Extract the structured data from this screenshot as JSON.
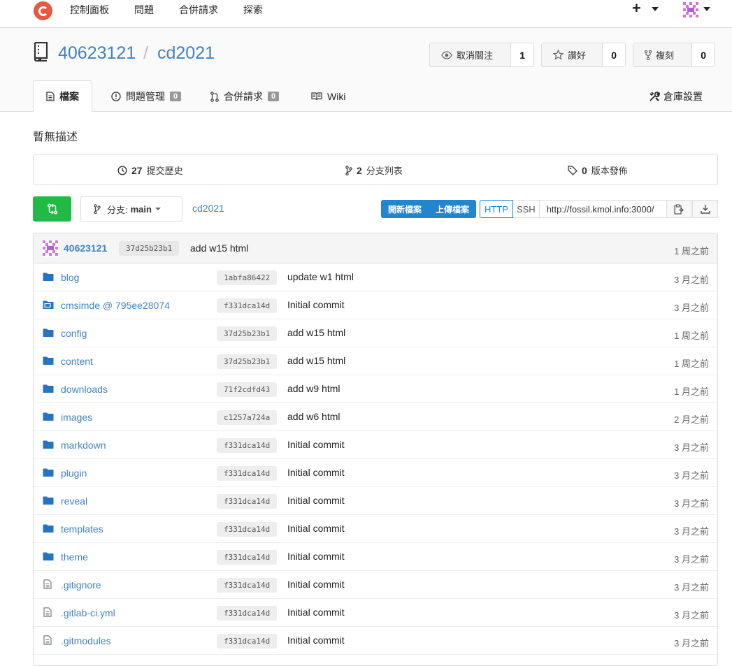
{
  "nav": {
    "items": [
      {
        "label": "控制面板"
      },
      {
        "label": "問題"
      },
      {
        "label": "合併請求"
      },
      {
        "label": "探索"
      }
    ],
    "plus": "+"
  },
  "repo": {
    "owner": "40623121",
    "separator": "/",
    "name": "cd2021",
    "watch_label": "取消關注",
    "watch_count": "1",
    "star_label": "讚好",
    "star_count": "0",
    "fork_label": "複刻",
    "fork_count": "0"
  },
  "tabs": [
    {
      "label": "檔案"
    },
    {
      "label": "問題管理",
      "badge": "0"
    },
    {
      "label": "合併請求",
      "badge": "0"
    },
    {
      "label": "Wiki"
    }
  ],
  "settings_label": "倉庫設置",
  "description": "暫無描述",
  "stats": {
    "commits_count": "27",
    "commits_label": "提交歷史",
    "branches_count": "2",
    "branches_label": "分支列表",
    "releases_count": "0",
    "releases_label": "版本發佈"
  },
  "toolbar": {
    "branch_prefix": "分支:",
    "branch_name": "main",
    "path": "cd2021",
    "new_file": "開新檔案",
    "upload_file": "上傳檔案",
    "http": "HTTP",
    "ssh": "SSH",
    "clone_url": "http://fossil.kmol.info:3000/"
  },
  "latest_commit": {
    "author": "40623121",
    "sha": "37d25b23b1",
    "message": "add w15 html",
    "age": "1 周之前"
  },
  "files": [
    {
      "type": "dir",
      "name": "blog",
      "sha": "1abfa86422",
      "message": "update w1 html",
      "age": "3 月之前"
    },
    {
      "type": "submodule",
      "name": "cmsimde @ 795ee28074",
      "sha": "f331dca14d",
      "message": "Initial commit",
      "age": "3 月之前"
    },
    {
      "type": "dir",
      "name": "config",
      "sha": "37d25b23b1",
      "message": "add w15 html",
      "age": "1 周之前"
    },
    {
      "type": "dir",
      "name": "content",
      "sha": "37d25b23b1",
      "message": "add w15 html",
      "age": "1 周之前"
    },
    {
      "type": "dir",
      "name": "downloads",
      "sha": "71f2cdfd43",
      "message": "add w9 html",
      "age": "1 月之前"
    },
    {
      "type": "dir",
      "name": "images",
      "sha": "c1257a724a",
      "message": "add w6 html",
      "age": "2 月之前"
    },
    {
      "type": "dir",
      "name": "markdown",
      "sha": "f331dca14d",
      "message": "Initial commit",
      "age": "3 月之前"
    },
    {
      "type": "dir",
      "name": "plugin",
      "sha": "f331dca14d",
      "message": "Initial commit",
      "age": "3 月之前"
    },
    {
      "type": "dir",
      "name": "reveal",
      "sha": "f331dca14d",
      "message": "Initial commit",
      "age": "3 月之前"
    },
    {
      "type": "dir",
      "name": "templates",
      "sha": "f331dca14d",
      "message": "Initial commit",
      "age": "3 月之前"
    },
    {
      "type": "dir",
      "name": "theme",
      "sha": "f331dca14d",
      "message": "Initial commit",
      "age": "3 月之前"
    },
    {
      "type": "file",
      "name": ".gitignore",
      "sha": "f331dca14d",
      "message": "Initial commit",
      "age": "3 月之前"
    },
    {
      "type": "file",
      "name": ".gitlab-ci.yml",
      "sha": "f331dca14d",
      "message": "Initial commit",
      "age": "3 月之前"
    },
    {
      "type": "file",
      "name": ".gitmodules",
      "sha": "f331dca14d",
      "message": "Initial commit",
      "age": "3 月之前"
    }
  ],
  "colors": {
    "link": "#4183c4",
    "green": "#21ba45",
    "blue": "#2185d0",
    "logo": "#e8573f"
  }
}
